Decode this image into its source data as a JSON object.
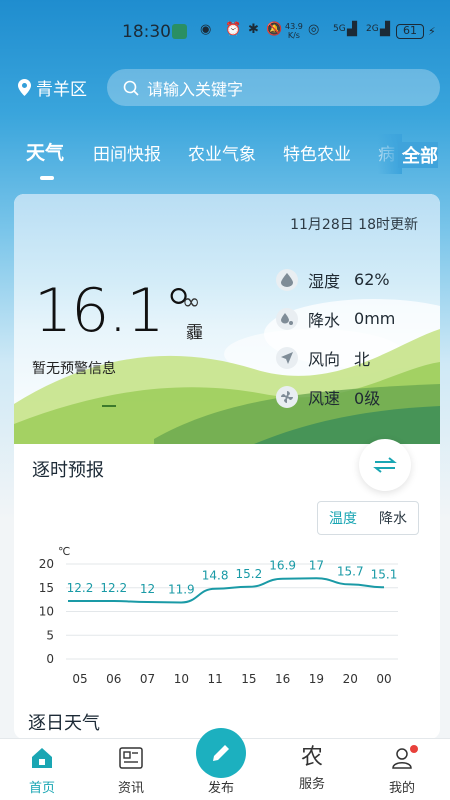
{
  "status": {
    "time": "18:30",
    "speed_top": "43.9",
    "speed_bottom": "K/s",
    "net1": "5G",
    "net2": "2G",
    "battery": "61"
  },
  "header": {
    "location": "青羊区",
    "search_placeholder": "请输入关键字"
  },
  "tabs": [
    {
      "label": "天气",
      "active": true
    },
    {
      "label": "田间快报"
    },
    {
      "label": "农业气象"
    },
    {
      "label": "特色农业"
    },
    {
      "label": "病"
    }
  ],
  "tab_all": "全部",
  "weather": {
    "updated": "11月28日 18时更新",
    "temperature": "16.1°",
    "condition_icon": "haze-icon",
    "condition": "霾",
    "alert": "暂无预警信息",
    "metrics": [
      {
        "icon": "humidity-icon",
        "label": "湿度",
        "value": "62%"
      },
      {
        "icon": "precipitation-icon",
        "label": "降水",
        "value": "0mm"
      },
      {
        "icon": "wind-direction-icon",
        "label": "风向",
        "value": "北"
      },
      {
        "icon": "wind-speed-icon",
        "label": "风速",
        "value": "0级"
      }
    ]
  },
  "hourly": {
    "title": "逐时预报",
    "toggle": {
      "temperature": "温度",
      "precipitation": "降水"
    }
  },
  "chart_data": {
    "type": "line",
    "categories": [
      "05",
      "06",
      "07",
      "10",
      "11",
      "15",
      "16",
      "19",
      "20",
      "00"
    ],
    "values": [
      12.2,
      12.2,
      12,
      11.9,
      14.8,
      15.2,
      16.9,
      17,
      15.7,
      15.1
    ],
    "unit": "℃",
    "ylim": [
      0,
      20
    ],
    "yticks": [
      0,
      5,
      10,
      15,
      20
    ],
    "grid": true,
    "color": "#1a9aa6"
  },
  "daily": {
    "title": "逐日天气"
  },
  "nav": {
    "home": "首页",
    "news": "资讯",
    "publish": "发布",
    "service_icon_char": "农",
    "service": "服务",
    "mine": "我的"
  },
  "colors": {
    "accent": "#1cb0bf",
    "brand_blue": "#1f8dcf"
  }
}
